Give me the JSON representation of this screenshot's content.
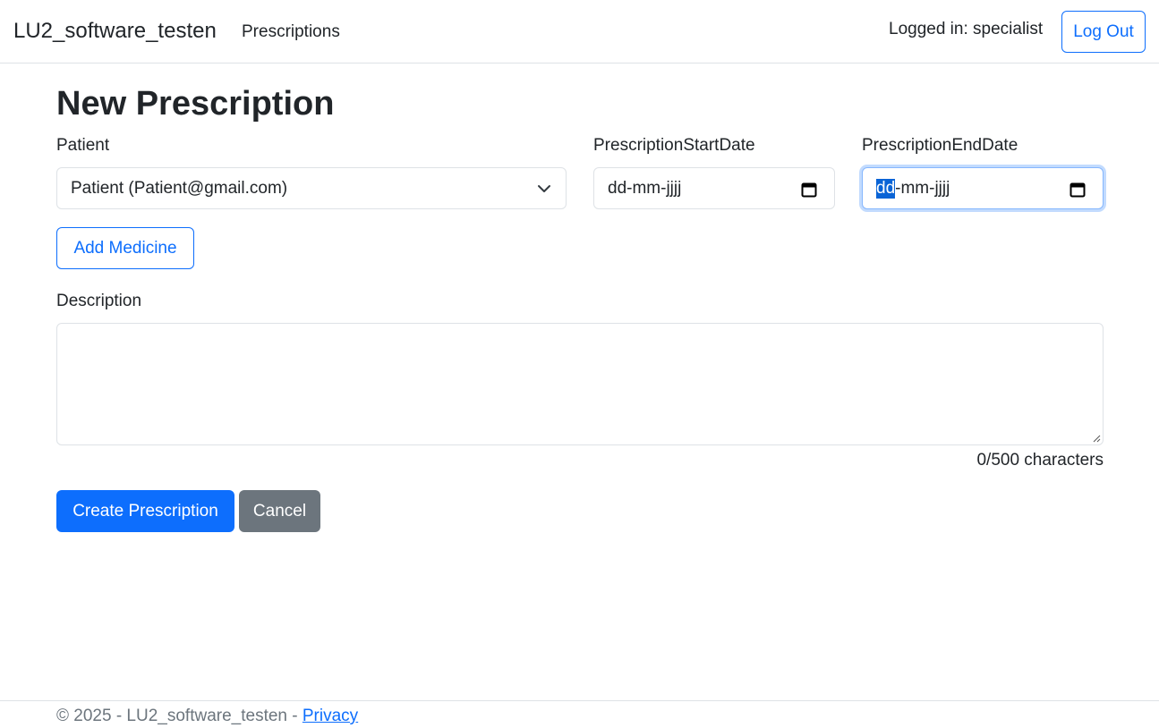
{
  "navbar": {
    "brand": "LU2_software_testen",
    "nav_link": "Prescriptions",
    "logged_in": "Logged in: specialist",
    "logout_label": "Log Out"
  },
  "page": {
    "title": "New Prescription"
  },
  "form": {
    "patient_label": "Patient",
    "patient_selected": "Patient (Patient@gmail.com)",
    "start_date_label": "PrescriptionStartDate",
    "start_date_placeholder": "dd-mm-jjjj",
    "end_date_label": "PrescriptionEndDate",
    "end_date_seg_day": "dd",
    "end_date_rest": "-mm-jjjj",
    "add_medicine_label": "Add Medicine",
    "description_label": "Description",
    "description_value": "",
    "char_count": "0/500 characters",
    "create_label": "Create Prescription",
    "cancel_label": "Cancel"
  },
  "footer": {
    "copyright": "© 2025 - LU2_software_testen - ",
    "privacy_link": "Privacy"
  },
  "colors": {
    "primary": "#0d6efd",
    "secondary": "#6c757d",
    "border": "#dee2e6",
    "text": "#212529"
  },
  "icons": {
    "select": "chevron-down-icon",
    "date": "calendar-icon",
    "resize": "resize-grip-icon"
  }
}
